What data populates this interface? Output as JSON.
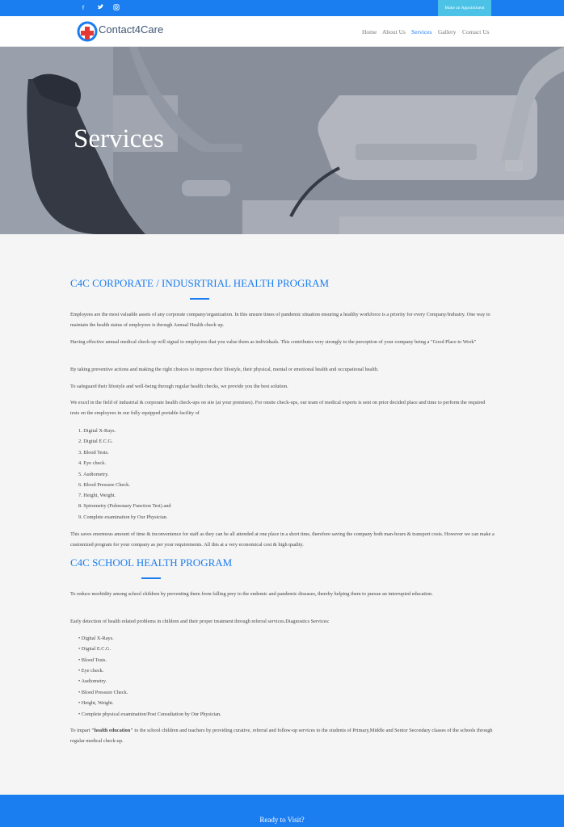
{
  "topbar": {
    "social": [
      {
        "icon": "facebook-icon",
        "glyph": "f"
      },
      {
        "icon": "twitter-icon",
        "glyph": "🐦"
      },
      {
        "icon": "instagram-icon",
        "glyph": "◎"
      }
    ],
    "appointment_button": "Make an Appointment"
  },
  "brand": {
    "name": "Contact4Care",
    "accent": "#1a7df0",
    "logo_red": "#e53935"
  },
  "nav": {
    "items": [
      "Home",
      "About Us",
      "Services",
      "Gallery",
      "Contact Us"
    ],
    "active": "Services"
  },
  "hero": {
    "title": "Services"
  },
  "section1": {
    "title": "C4C CORPORATE / INDUSRTRIAL HEALTH PROGRAM",
    "paragraphs": [
      "Employees are the most valuable assets of any corporate company/organization. In this unsure times of pandemic situation ensuring a healthy workforce is a priority for every Company/Industry. One way to maintain the health status of employees is through Annual Health check up.",
      "Having effective annual medical check-up will signal to employees that you value them as individuals. This contributes very strongly to the perception of your company being a \"Good Place to Work\"",
      "By taking preventive actions and making the right choices to improve their lifestyle, their physical, mental or emotional health and occupational health.",
      "To safeguard their lifestyle and well-being through regular health checks, we provide you the best solution.",
      "We excel in the field of industrial & corporate health check-ups on site (at your premises). For onsite check-ups, our team of medical experts is sent on prior decided place and time to perform the required tests on the employees in our fully equipped portable facility of"
    ],
    "list": [
      "1. Digital X-Rays.",
      "2. Digital E.C.G.",
      "3. Blood Tests.",
      "4. Eye check.",
      "5. Audiometry.",
      "6. Blood Pressure Check.",
      "7. Height, Weight.",
      "8. Spirometry (Pulmonary Function Test) and",
      "9. Complete examination by Our Physician."
    ],
    "closing": "This saves enormous amount of time & inconvenience for staff as they can be all attended at one place in a short time, therefore saving the company both man-hours & transport costs. However we can make a customized program for your company as per your requirements. All this at a very economical cost & high quality."
  },
  "section2": {
    "title": "C4C SCHOOL HEALTH PROGRAM",
    "paragraphs": [
      "To reduce morbidity among school children by preventing them from falling prey to the endemic and pandemic diseases, thereby helping them to pursue an interrupted education.",
      "Early detection of health related problems in children and their proper treatment through referral services.Diagnostics Services:"
    ],
    "list": [
      "Digital X-Rays.",
      "Digital E.C.G.",
      "Blood Tests.",
      "Eye check.",
      "Audiometry.",
      "Blood Pressure Check.",
      "Height, Weight.",
      "Complete physical examination/Post Consultation by Our Physician."
    ],
    "closing_prefix": "To impart ",
    "closing_bold": "\"health education\"",
    "closing_suffix": " to the school children and teachers by providing curative, referral and follow-up services to the students of Primary,Middle and Senior Secondary classes of the schools through regular medical check-up."
  },
  "footer": {
    "cta": "Ready to Visit?"
  }
}
